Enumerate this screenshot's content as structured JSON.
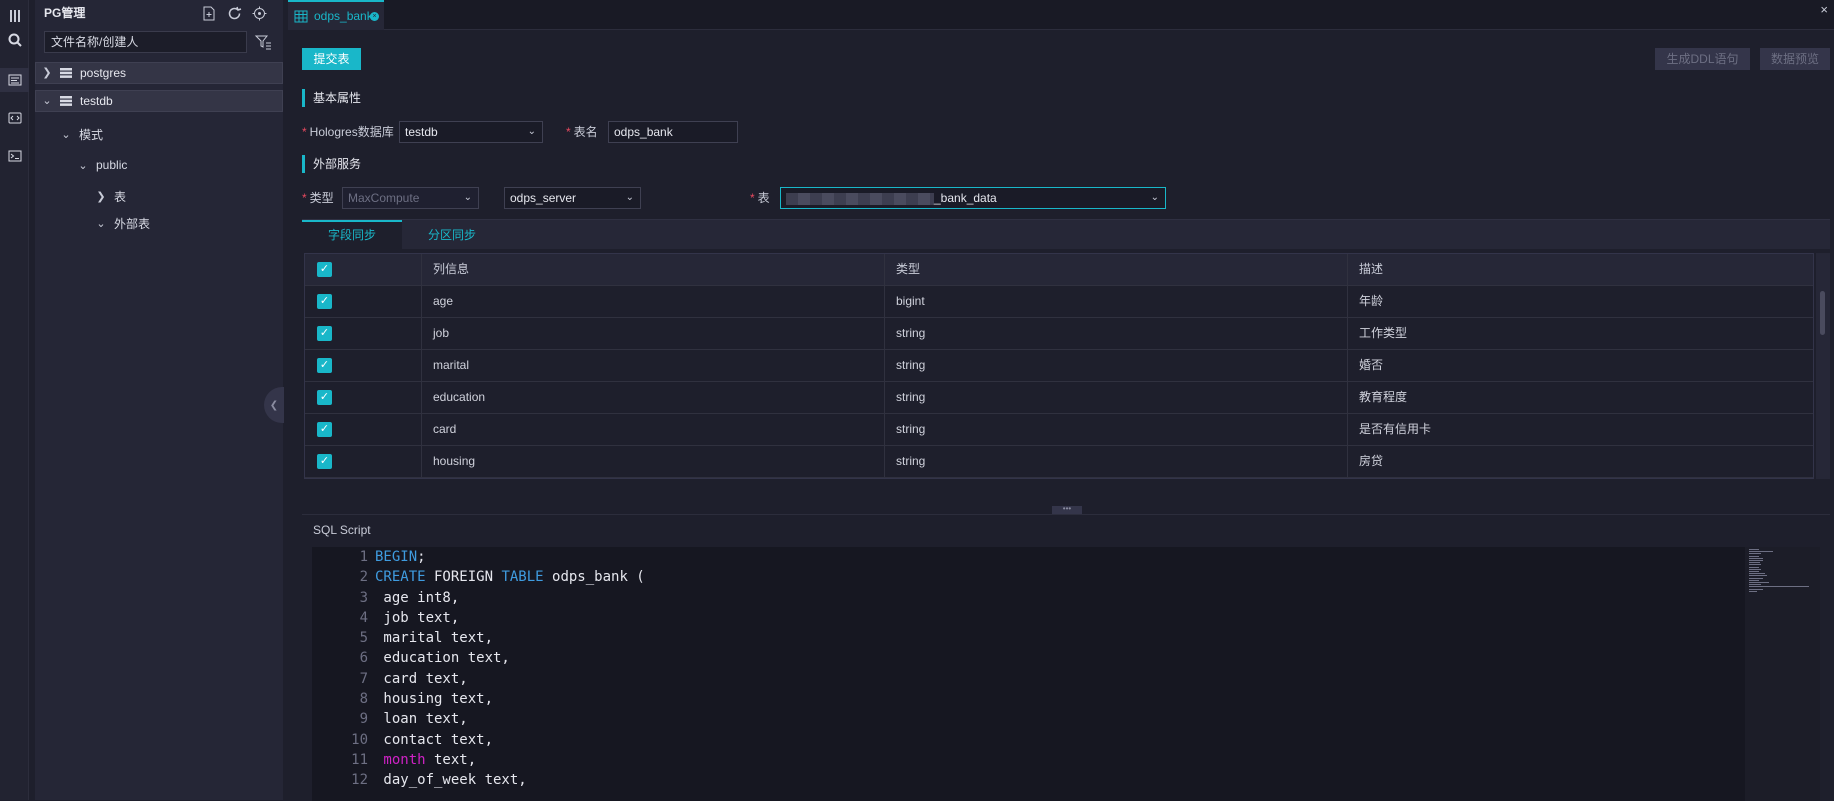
{
  "sidebar": {
    "title": "PG管理",
    "search_placeholder": "文件名称/创建人",
    "tree": [
      {
        "label": "postgres"
      },
      {
        "label": "testdb"
      },
      {
        "label": "模式"
      },
      {
        "label": "public"
      },
      {
        "label": "表"
      },
      {
        "label": "外部表"
      }
    ]
  },
  "tabs": [
    {
      "label": "odps_bank"
    }
  ],
  "toolbar": {
    "submit_label": "提交表",
    "ddl_label": "生成DDL语句",
    "preview_label": "数据预览"
  },
  "basic": {
    "section_title": "基本属性",
    "db_label": "Hologres数据库",
    "db_value": "testdb",
    "table_name_label": "表名",
    "table_name_value": "odps_bank"
  },
  "external": {
    "section_title": "外部服务",
    "type_label": "类型",
    "type_value": "MaxCompute",
    "server_value": "odps_server",
    "table_label": "表",
    "table_value_suffix": "_bank_data"
  },
  "subtabs": [
    {
      "label": "字段同步"
    },
    {
      "label": "分区同步"
    }
  ],
  "grid": {
    "headers": [
      "列信息",
      "类型",
      "描述"
    ],
    "rows": [
      {
        "name": "age",
        "type": "bigint",
        "desc": "年龄"
      },
      {
        "name": "job",
        "type": "string",
        "desc": "工作类型"
      },
      {
        "name": "marital",
        "type": "string",
        "desc": "婚否"
      },
      {
        "name": "education",
        "type": "string",
        "desc": "教育程度"
      },
      {
        "name": "card",
        "type": "string",
        "desc": "是否有信用卡"
      },
      {
        "name": "housing",
        "type": "string",
        "desc": "房贷"
      }
    ]
  },
  "sql": {
    "title": "SQL Script",
    "line_numbers": [
      "1",
      "2",
      "3",
      "4",
      "5",
      "6",
      "7",
      "8",
      "9",
      "10",
      "11",
      "12"
    ],
    "lines": [
      {
        "kw": "BEGIN",
        "rest": ";"
      },
      {
        "kw": "CREATE",
        "rest": " FOREIGN ",
        "kw2": "TABLE",
        "rest2": " odps_bank ("
      },
      {
        "rest": " age int8,"
      },
      {
        "rest": " job text,"
      },
      {
        "rest": " marital text,"
      },
      {
        "rest": " education text,"
      },
      {
        "rest": " card text,"
      },
      {
        "rest": " housing text,"
      },
      {
        "rest": " loan text,"
      },
      {
        "rest": " contact text,"
      },
      {
        "mag": " month",
        "rest": " text,"
      },
      {
        "rest": " day_of_week text,"
      }
    ]
  },
  "colors": {
    "accent": "#19b7c9",
    "required": "#e84a5f",
    "keyword": "#3f9ce0"
  }
}
